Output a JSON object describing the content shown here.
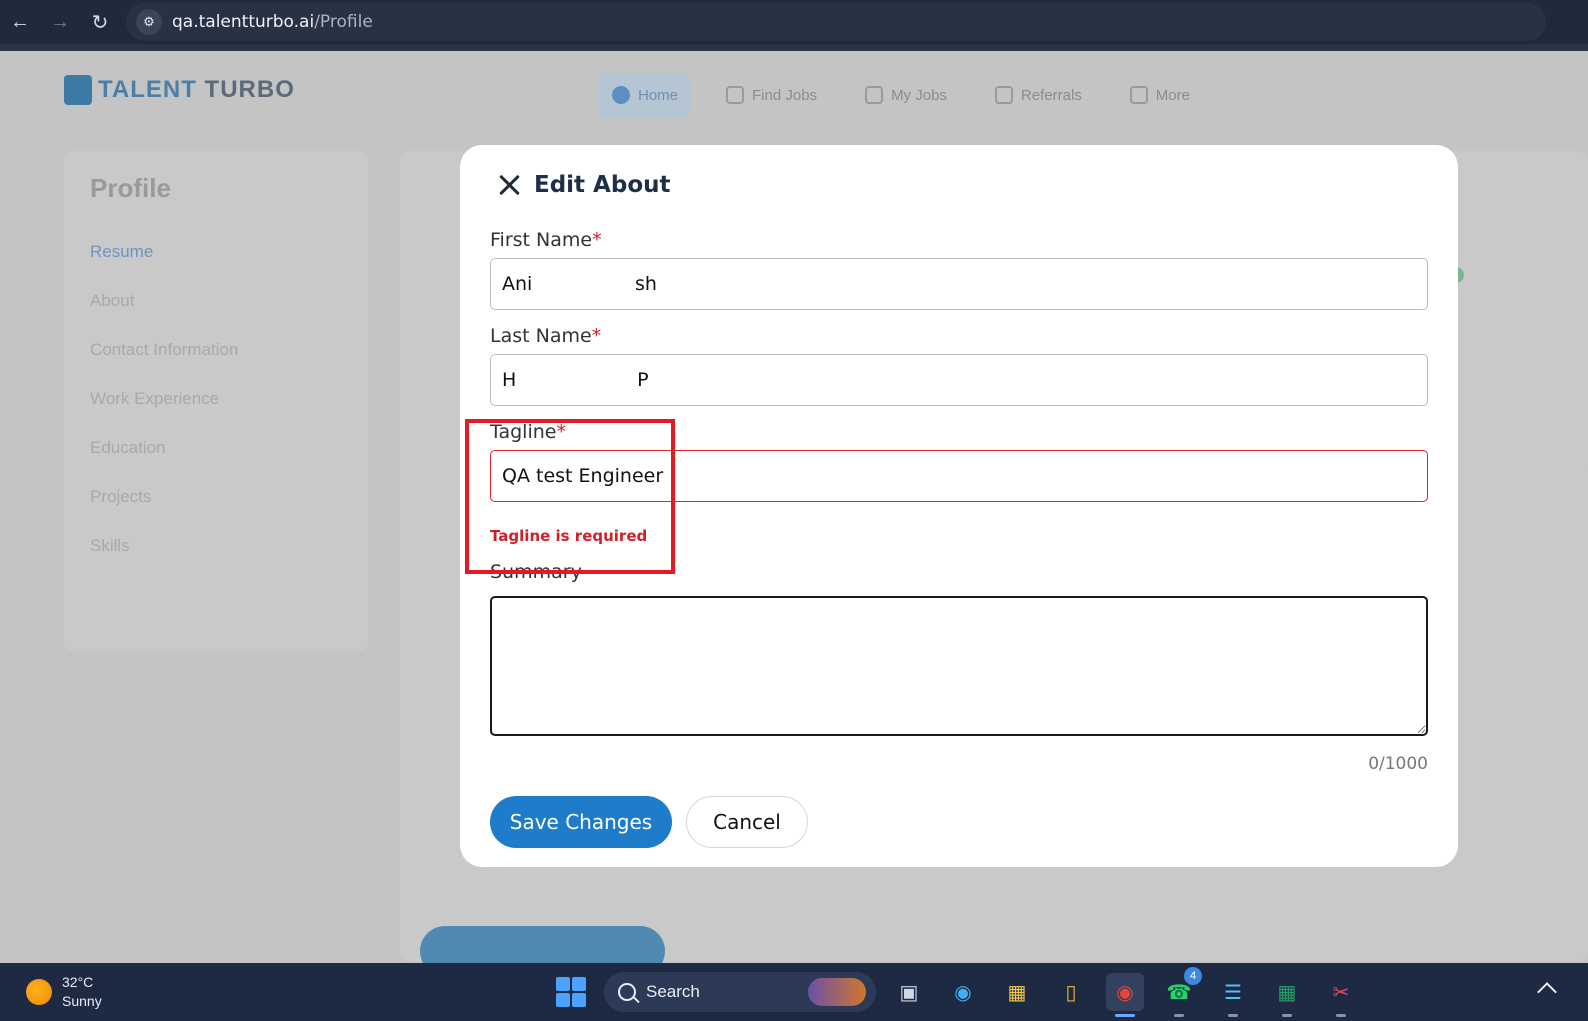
{
  "browser": {
    "url_host": "qa.talentturbo.ai",
    "url_path": "/Profile"
  },
  "background": {
    "logo": {
      "part1": "TALENT",
      "part2": "TURBO"
    },
    "nav": [
      "Home",
      "Find Jobs",
      "My Jobs",
      "Referrals",
      "More"
    ],
    "sidebar_title": "Profile",
    "sidebar_items": [
      "Resume",
      "About",
      "Contact Information",
      "Work Experience",
      "Education",
      "Projects",
      "Skills"
    ]
  },
  "modal": {
    "title": "Edit About",
    "first_name": {
      "label": "First Name",
      "required_mark": "*",
      "value": "Ani                 sh"
    },
    "last_name": {
      "label": "Last Name",
      "required_mark": "*",
      "value": "H                    P"
    },
    "tagline": {
      "label": "Tagline",
      "required_mark": "*",
      "value": "QA test Engineer",
      "error": "Tagline is required"
    },
    "summary": {
      "label": "Summary",
      "value": "",
      "counter": "0/1000"
    },
    "save_label": "Save Changes",
    "cancel_label": "Cancel"
  },
  "taskbar": {
    "weather_temp": "32°C",
    "weather_desc": "Sunny",
    "search_label": "Search",
    "whatsapp_badge": "4"
  },
  "colors": {
    "primary": "#1f7ccb",
    "error": "#d0202a",
    "highlight": "#e01b24"
  }
}
